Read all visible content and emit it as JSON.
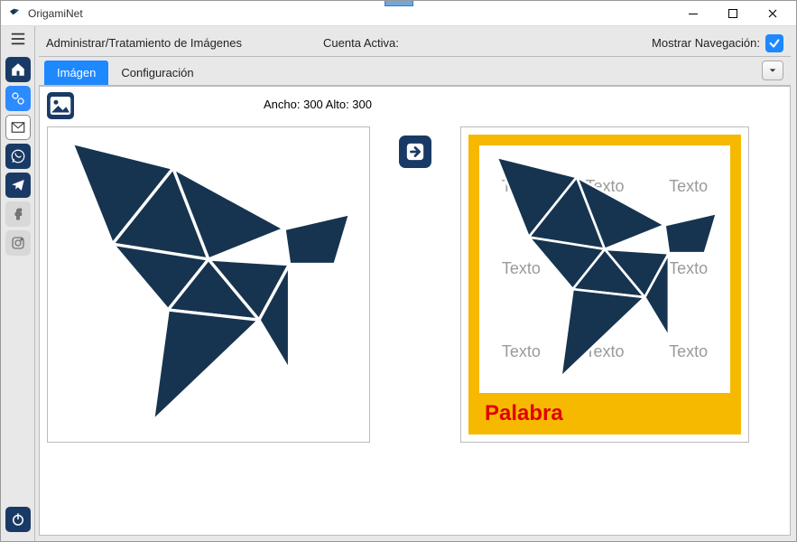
{
  "app": {
    "title": "OrigamiNet"
  },
  "topstrip": {
    "breadcrumb": "Administrar/Tratamiento de Imágenes",
    "account_label": "Cuenta Activa:",
    "show_nav_label": "Mostrar Navegación:",
    "show_nav_checked": true
  },
  "tabs": {
    "items": [
      {
        "label": "Imágen",
        "active": true
      },
      {
        "label": "Configuración",
        "active": false
      }
    ]
  },
  "workspace": {
    "dimensions_label": "Ancho: 300 Alto: 300"
  },
  "card": {
    "caption": "Palabra",
    "watermark": "Texto",
    "bg_color": "#f7b900",
    "caption_color": "#e00000"
  },
  "bird_color": "#16344f"
}
